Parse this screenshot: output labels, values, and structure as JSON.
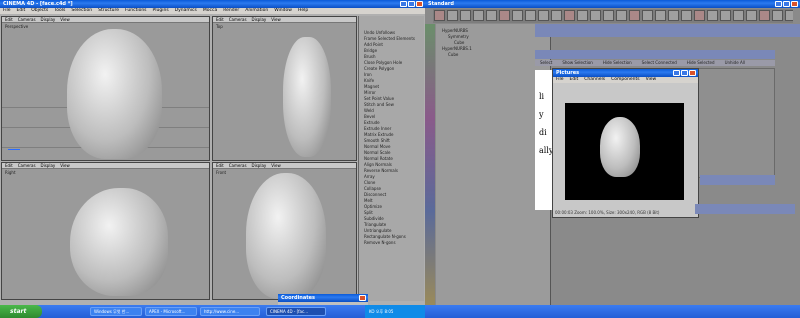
{
  "c4d": {
    "title": "CINEMA 4D - [face.c4d *]",
    "menus": [
      "File",
      "Edit",
      "Objects",
      "Tools",
      "Selection",
      "Structure",
      "Functions",
      "Plugins",
      "Dynamics",
      "Mocca",
      "Render",
      "Animation",
      "Window",
      "Help"
    ],
    "vp_menu": [
      "Edit",
      "Cameras",
      "Display",
      "View"
    ],
    "vp_labels": {
      "persp": "Perspective",
      "top": "Top",
      "right": "Right",
      "front": "Front"
    }
  },
  "tools": {
    "items": [
      "Undo Unfollows",
      "Frame Selected Elements",
      "Add Point",
      "Bridge",
      "Brush",
      "Close Polygon Hole",
      "Create Polygon",
      "Iron",
      "Knife",
      "Magnet",
      "Mirror",
      "Set Point Value",
      "Stitch and Sew",
      "Weld",
      "Bevel",
      "Extrude",
      "Extrude Inner",
      "Matrix Extrude",
      "Smooth Shift",
      "Normal Move",
      "Normal Scale",
      "Normal Rotate",
      "Align Normals",
      "Reverse Normals",
      "Array",
      "Clone",
      "Collapse",
      "Disconnect",
      "Melt",
      "Optimize",
      "Split",
      "Subdivide",
      "Triangulate",
      "Untriangulate",
      "Rectangulate N-gons",
      "Remove N-gons"
    ]
  },
  "coordinates": {
    "title": "Coordinates"
  },
  "standard": {
    "title": "Standard",
    "objects": [
      {
        "name": "HyperNURBS",
        "indent": 0
      },
      {
        "name": "Symmetry",
        "indent": 1
      },
      {
        "name": "Cube",
        "indent": 2
      },
      {
        "name": "HyperNURBS.1",
        "indent": 0
      },
      {
        "name": "Cube",
        "indent": 1
      }
    ]
  },
  "bg_tabs": [
    "Select",
    "Show Selection",
    "Hide Selection",
    "Select Connected",
    "Hide Selected",
    "Unhide All"
  ],
  "bg_text": [
    "li",
    "y",
    "di",
    "ally"
  ],
  "pictures": {
    "title": "Pictures",
    "menus": [
      "File",
      "Edit",
      "Channels",
      "Components",
      "View"
    ],
    "status": "00:00:03  Zoom: 100.0%, Size: 300x240, RGB (8 Bit)"
  },
  "taskbar": {
    "start": "start",
    "lang": "KO",
    "clock": "오후 8:05",
    "tasks": [
      "Windows 무엇 한...",
      "APEX - Microsoft...",
      "http://www.cine...",
      "CINEMA 4D - [fac..."
    ]
  }
}
